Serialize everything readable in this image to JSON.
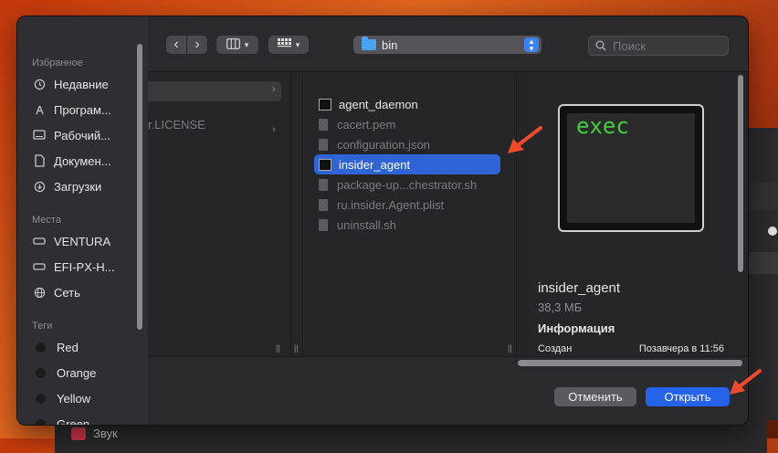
{
  "background": {
    "partial_label": "Звук"
  },
  "sidebar": {
    "favorites_header": "Избранное",
    "favorites": [
      {
        "label": "Недавние",
        "icon": "clock-icon"
      },
      {
        "label": "Програм...",
        "icon": "applications-icon"
      },
      {
        "label": "Рабочий...",
        "icon": "desktop-icon"
      },
      {
        "label": "Докумен...",
        "icon": "document-icon"
      },
      {
        "label": "Загрузки",
        "icon": "download-icon"
      }
    ],
    "places_header": "Места",
    "places": [
      {
        "label": "VENTURA",
        "icon": "drive-icon"
      },
      {
        "label": "EFI-PX-H...",
        "icon": "drive-icon"
      },
      {
        "label": "Сеть",
        "icon": "globe-icon"
      }
    ],
    "tags_header": "Теги",
    "tags": [
      {
        "label": "Red"
      },
      {
        "label": "Orange"
      },
      {
        "label": "Yellow"
      },
      {
        "label": "Green"
      }
    ]
  },
  "toolbar": {
    "back": "‹",
    "forward": "›",
    "view_icon": "columns-view-icon",
    "group_icon": "grid-group-icon",
    "path": "bin",
    "search_placeholder": "Поиск"
  },
  "column1": {
    "partial_item": "r.LICENSE"
  },
  "files": [
    {
      "name": "agent_daemon",
      "kind": "exec",
      "dim": false,
      "selected": false
    },
    {
      "name": "cacert.pem",
      "kind": "doc",
      "dim": true,
      "selected": false
    },
    {
      "name": "configuration.json",
      "kind": "doc",
      "dim": true,
      "selected": false
    },
    {
      "name": "insider_agent",
      "kind": "exec",
      "dim": false,
      "selected": true
    },
    {
      "name": "package-up...chestrator.sh",
      "kind": "doc",
      "dim": true,
      "selected": false
    },
    {
      "name": "ru.insider.Agent.plist",
      "kind": "doc",
      "dim": true,
      "selected": false
    },
    {
      "name": "uninstall.sh",
      "kind": "doc",
      "dim": true,
      "selected": false
    }
  ],
  "preview": {
    "icon_text": "exec",
    "name": "insider_agent",
    "size": "38,3 МБ",
    "info_header": "Информация",
    "created_label": "Создан",
    "created_value": "Позавчера в 11:56"
  },
  "footer": {
    "cancel": "Отменить",
    "open": "Открыть"
  },
  "colors": {
    "accent": "#2563eb",
    "selection": "#2f64d6",
    "annotation_arrow": "#f04a2a",
    "exec_text": "#40d040"
  }
}
